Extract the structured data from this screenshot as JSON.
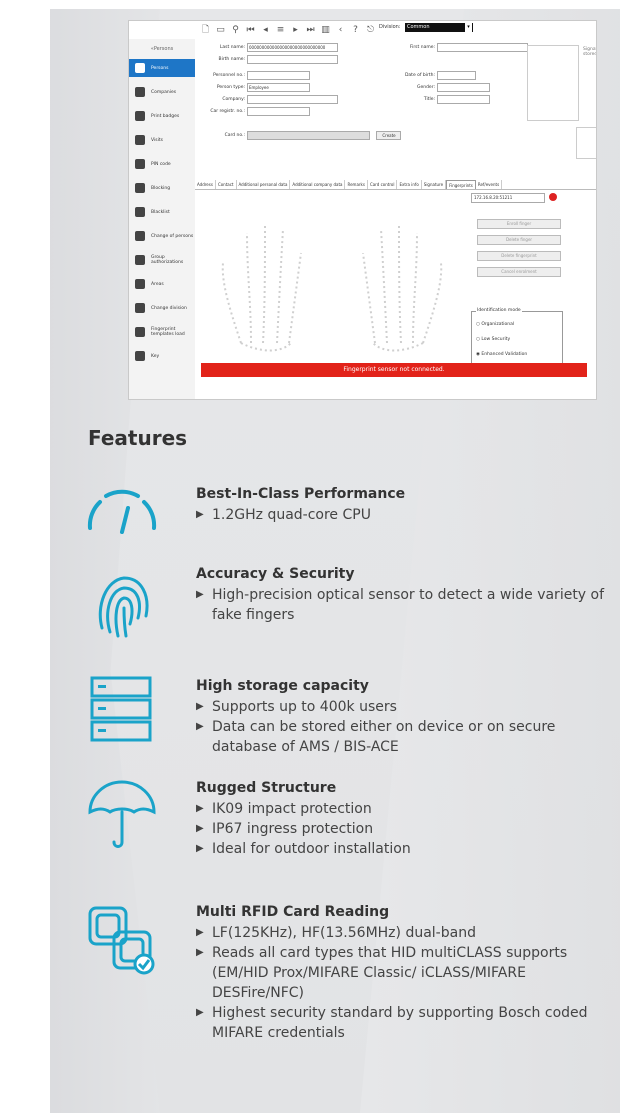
{
  "screenshot": {
    "toolbar": {
      "icons": [
        "doc-icon",
        "save-icon",
        "search-icon",
        "first-icon",
        "prev-icon",
        "list-icon",
        "next-icon",
        "last-icon",
        "grid-icon",
        "back-icon",
        "help-icon",
        "exit-icon"
      ]
    },
    "division_label": "Division:",
    "division_value": "Common",
    "sidebar": {
      "head": "«Persons",
      "items": [
        {
          "label": "Persons",
          "active": true
        },
        {
          "label": "Companies"
        },
        {
          "label": "Print badges"
        },
        {
          "label": "Visits"
        },
        {
          "label": "PIN code"
        },
        {
          "label": "Blocking"
        },
        {
          "label": "Blacklist"
        },
        {
          "label": "Change of persons"
        },
        {
          "label": "Group authorizations"
        },
        {
          "label": "Areas"
        },
        {
          "label": "Change division"
        },
        {
          "label": "Fingerprint templates load"
        },
        {
          "label": "Key"
        }
      ]
    },
    "form": {
      "last_name_label": "Last name:",
      "last_name_value": "000000000000000000000000000000",
      "first_name_label": "First name:",
      "birth_name_label": "Birth name:",
      "personnel_no_label": "Personnel no.:",
      "date_of_birth_label": "Date of birth:",
      "person_type_label": "Person type:",
      "person_type_value": "Employee",
      "gender_label": "Gender:",
      "company_label": "Company:",
      "title_label": "Title:",
      "car_reg_label": "Car registr. no.:",
      "card_no_label": "Card no.:",
      "create_label": "Create",
      "checkbox_label": "Signature stored"
    },
    "tabs": [
      "Address",
      "Contact",
      "Additional personal data",
      "Additional company data",
      "Remarks",
      "Card control",
      "Extra info",
      "Signature",
      "Fingerprints",
      "Ref/events"
    ],
    "active_tab": "Fingerprints",
    "device_value": "172.16.8.20:51211",
    "buttons": [
      "Enroll finger",
      "Delete finger",
      "Delete fingerprint",
      "Cancel enrolment"
    ],
    "identification_mode": {
      "title": "Identification mode",
      "options": [
        "Organizational",
        "Low Security",
        "Enhanced Validation"
      ],
      "selected": "Enhanced Validation"
    },
    "error_message": "Fingerprint sensor not connected."
  },
  "features": {
    "title": "Features",
    "items": [
      {
        "icon": "speedometer-icon",
        "heading": "Best-In-Class Performance",
        "bullets": [
          "1.2GHz quad-core CPU"
        ]
      },
      {
        "icon": "fingerprint-icon",
        "heading": "Accuracy & Security",
        "bullets": [
          "High-precision optical sensor to detect a wide variety of fake fingers"
        ]
      },
      {
        "icon": "server-icon",
        "heading": "High storage capacity",
        "bullets": [
          "Supports up to 400k users",
          "Data can be stored either on device or on secure database of AMS / BIS-ACE"
        ]
      },
      {
        "icon": "umbrella-icon",
        "heading": "Rugged Structure",
        "bullets": [
          "IK09 impact protection",
          "IP67 ingress protection",
          "Ideal for outdoor installation"
        ]
      },
      {
        "icon": "rfid-card-icon",
        "heading": "Multi RFID Card Reading",
        "bullets": [
          "LF(125KHz), HF(13.56MHz) dual-band",
          "Reads all card types that HID multiCLASS supports (EM/HID Prox/MIFARE Classic/ iCLASS/MIFARE DESFire/NFC)",
          "Highest security standard by supporting Bosch coded MIFARE credentials"
        ]
      }
    ]
  },
  "colors": {
    "accent_blue": "#1e76c7",
    "icon_teal": "#1aa3c9",
    "error_red": "#e2231a"
  }
}
